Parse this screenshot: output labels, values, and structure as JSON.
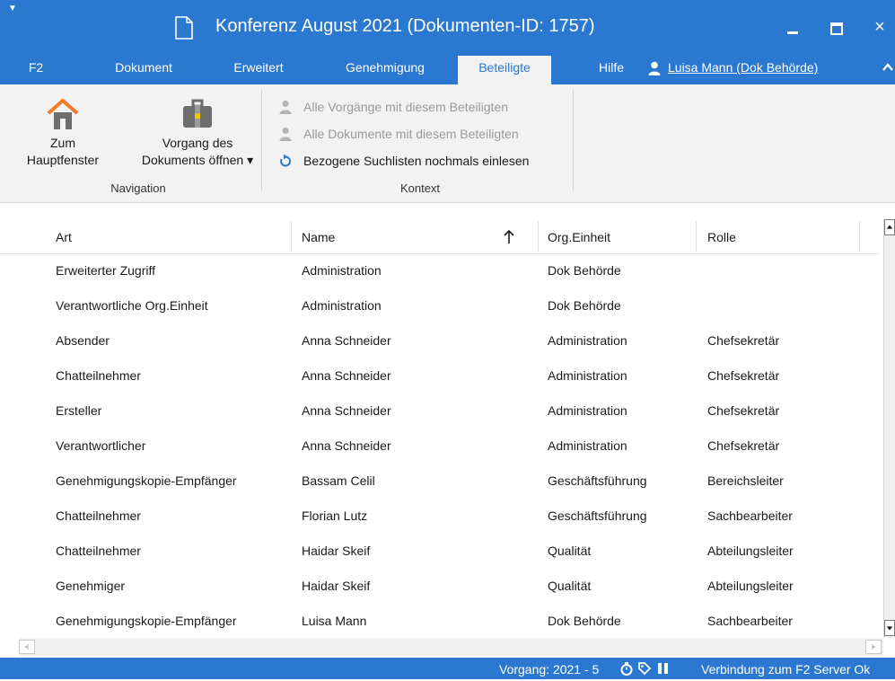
{
  "window": {
    "title": "Konferenz August 2021 (Dokumenten-ID: 1757)",
    "close_glyph": "×"
  },
  "tabs": [
    {
      "label": "F2"
    },
    {
      "label": "Dokument"
    },
    {
      "label": "Erweitert"
    },
    {
      "label": "Genehmigung"
    },
    {
      "label": "Beteiligte"
    },
    {
      "label": "Hilfe"
    }
  ],
  "active_tab": "Beteiligte",
  "user": {
    "label": "Luisa Mann (Dok Behörde)"
  },
  "ribbon": {
    "navigation": {
      "home_label_1": "Zum",
      "home_label_2": "Hauptfenster",
      "open_label_1": "Vorgang des",
      "open_label_2": "Dokuments öffnen ▾",
      "group_label": "Navigation"
    },
    "context": {
      "items": [
        {
          "label": "Alle Vorgänge mit diesem Beteiligten",
          "enabled": false,
          "icon": "person-icon"
        },
        {
          "label": "Alle Dokumente mit diesem Beteiligten",
          "enabled": false,
          "icon": "person-icon"
        },
        {
          "label": "Bezogene Suchlisten nochmals einlesen",
          "enabled": true,
          "icon": "refresh-icon"
        }
      ],
      "group_label": "Kontext"
    }
  },
  "table": {
    "columns": [
      "Art",
      "Name",
      "Org.Einheit",
      "Rolle"
    ],
    "sorted_by": "Name",
    "sort_direction": "ascending",
    "rows": [
      [
        "Erweiterter Zugriff",
        "Administration",
        "Dok Behörde",
        ""
      ],
      [
        "Verantwortliche Org.Einheit",
        "Administration",
        "Dok Behörde",
        ""
      ],
      [
        "Absender",
        "Anna Schneider",
        "Administration",
        "Chefsekretär"
      ],
      [
        "Chatteilnehmer",
        "Anna Schneider",
        "Administration",
        "Chefsekretär"
      ],
      [
        "Ersteller",
        "Anna Schneider",
        "Administration",
        "Chefsekretär"
      ],
      [
        "Verantwortlicher",
        "Anna Schneider",
        "Administration",
        "Chefsekretär"
      ],
      [
        "Genehmigungskopie-Empfänger",
        "Bassam Celil",
        "Geschäftsführung",
        "Bereichsleiter"
      ],
      [
        "Chatteilnehmer",
        "Florian Lutz",
        "Geschäftsführung",
        "Sachbearbeiter"
      ],
      [
        "Chatteilnehmer",
        "Haidar Skeif",
        "Qualität",
        "Abteilungsleiter"
      ],
      [
        "Genehmiger",
        "Haidar Skeif",
        "Qualität",
        "Abteilungsleiter"
      ],
      [
        "Genehmigungskopie-Empfänger",
        "Luisa Mann",
        "Dok Behörde",
        "Sachbearbeiter"
      ]
    ]
  },
  "status": {
    "vorgang": "Vorgang: 2021 - 5",
    "connection": "Verbindung zum F2 Server Ok"
  },
  "colors": {
    "brand_blue": "#2b78d0",
    "ribbon_bg": "#f2f2f2",
    "disabled_text": "#9a9a9a"
  }
}
